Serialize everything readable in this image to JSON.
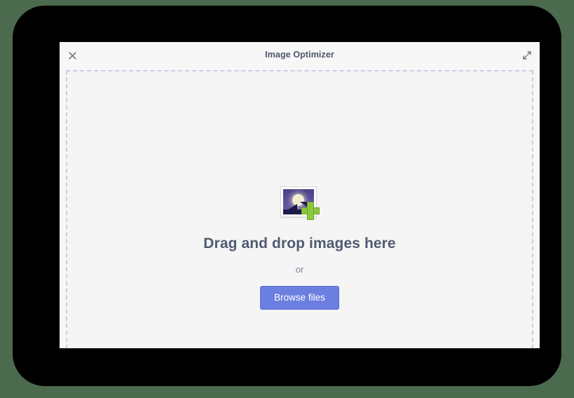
{
  "window": {
    "title": "Image Optimizer",
    "close_label": "Close",
    "expand_label": "Expand"
  },
  "drop_zone": {
    "heading": "Drag and drop images here",
    "separator": "or",
    "browse_button_label": "Browse files",
    "icon_name": "add-image-icon"
  },
  "colors": {
    "desktop_background": "#4c6b4e",
    "bezel": "#000000",
    "window_background": "#f7f7f8",
    "drop_zone_background": "#f5f5f6",
    "dashed_border": "#c6d0e0",
    "title_text": "#4e5668",
    "heading_text": "#505a70",
    "muted_text": "#7b8494",
    "button_background": "#6b7fe0",
    "button_border": "#5a6ed2",
    "button_text": "#ffffff",
    "icon_plus_green": "#8dc63f",
    "icon_sky": "#5c4f9b",
    "icon_sun": "#f3edd2",
    "icon_mountain": "#1d1b4b"
  }
}
